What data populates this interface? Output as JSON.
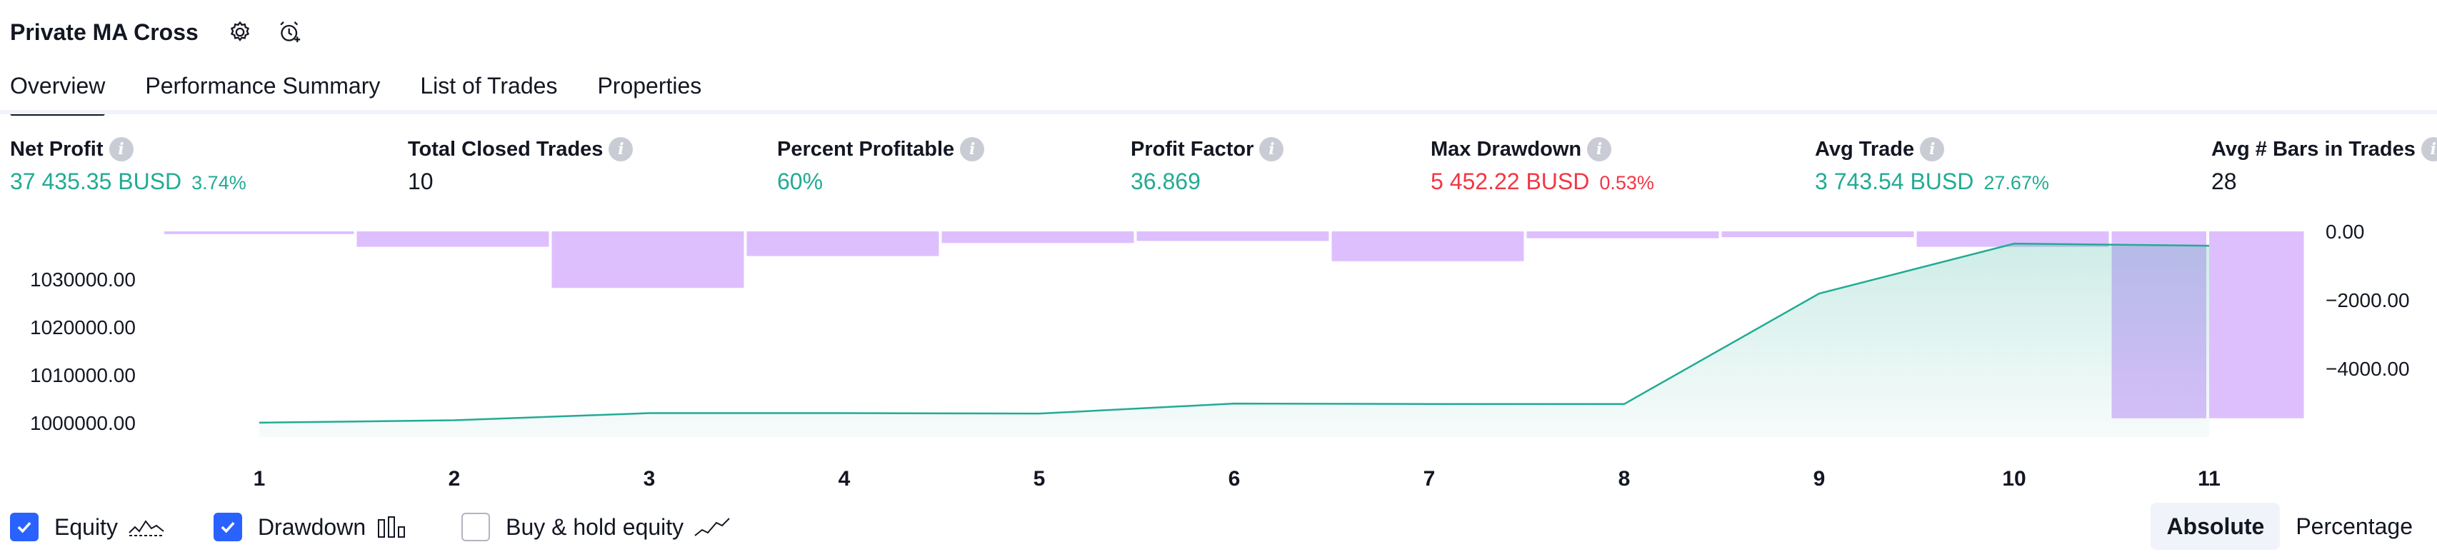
{
  "header": {
    "title": "Private MA Cross",
    "settings_icon": "gear-icon",
    "alert_icon": "alarm-clock-add-icon"
  },
  "tabs": [
    {
      "label": "Overview",
      "active": true
    },
    {
      "label": "Performance Summary",
      "active": false
    },
    {
      "label": "List of Trades",
      "active": false
    },
    {
      "label": "Properties",
      "active": false
    }
  ],
  "metrics": [
    {
      "label": "Net Profit",
      "value": "37 435.35 BUSD",
      "pct": "3.74%",
      "tone": "green"
    },
    {
      "label": "Total Closed Trades",
      "value": "10",
      "pct": "",
      "tone": "plain"
    },
    {
      "label": "Percent Profitable",
      "value": "60%",
      "pct": "",
      "tone": "green"
    },
    {
      "label": "Profit Factor",
      "value": "36.869",
      "pct": "",
      "tone": "green"
    },
    {
      "label": "Max Drawdown",
      "value": "5 452.22 BUSD",
      "pct": "0.53%",
      "tone": "red"
    },
    {
      "label": "Avg Trade",
      "value": "3 743.54 BUSD",
      "pct": "27.67%",
      "tone": "green"
    },
    {
      "label": "Avg # Bars in Trades",
      "value": "28",
      "pct": "",
      "tone": "plain"
    }
  ],
  "chart_data": {
    "type": "area",
    "x": [
      1,
      2,
      3,
      4,
      5,
      6,
      7,
      8,
      9,
      10,
      11
    ],
    "left_axis": {
      "ticks": [
        "1030000.00",
        "1020000.00",
        "1010000.00",
        "1000000.00"
      ],
      "ylim": [
        997000,
        1040000
      ]
    },
    "right_axis": {
      "ticks": [
        "0.00",
        "−2000.00",
        "−4000.00"
      ],
      "ylim": [
        -6000,
        0
      ]
    },
    "series": [
      {
        "name": "Equity",
        "kind": "line-area",
        "color": "#22ab94",
        "x": [
          1,
          2,
          3,
          4,
          5,
          6,
          7,
          8,
          9,
          10,
          11
        ],
        "values": [
          1000000,
          1000500,
          1002000,
          1002000,
          1001900,
          1004000,
          1003900,
          1003900,
          1027000,
          1037435,
          1037000
        ]
      },
      {
        "name": "Drawdown",
        "kind": "bars",
        "color": "#d8b4fe",
        "x": [
          0.5,
          1.5,
          2.5,
          3.5,
          4.5,
          5.5,
          6.5,
          7.5,
          8.5,
          9.5,
          10.5,
          11.0
        ],
        "values": [
          -80,
          -450,
          -1650,
          -720,
          -340,
          -280,
          -870,
          -200,
          -170,
          -450,
          -5452,
          -5452
        ]
      }
    ]
  },
  "legend": [
    {
      "label": "Equity",
      "checked": true,
      "icon": "equity-line-icon"
    },
    {
      "label": "Drawdown",
      "checked": true,
      "icon": "drawdown-bars-icon"
    },
    {
      "label": "Buy & hold equity",
      "checked": false,
      "icon": "buy-hold-line-icon"
    }
  ],
  "mode": {
    "options": [
      "Absolute",
      "Percentage"
    ],
    "selected": "Absolute"
  }
}
